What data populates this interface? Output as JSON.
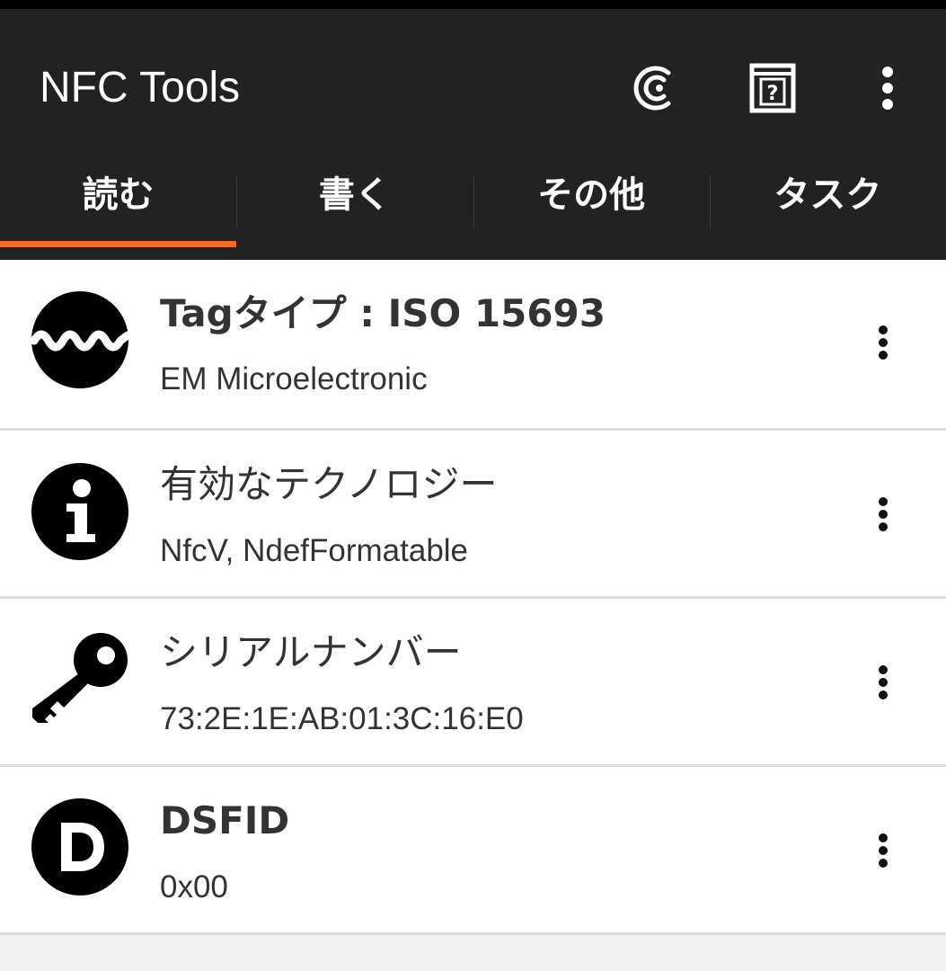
{
  "app": {
    "title": "NFC Tools",
    "actions": [
      {
        "icon": "nfc-c-icon"
      },
      {
        "icon": "help-box-icon",
        "symbol": "?"
      },
      {
        "icon": "overflow-menu-icon"
      }
    ]
  },
  "tabs": [
    {
      "label": "読む",
      "selected": true
    },
    {
      "label": "書く",
      "selected": false
    },
    {
      "label": "その他",
      "selected": false
    },
    {
      "label": "タスク",
      "selected": false
    }
  ],
  "colors": {
    "appbar": "#222222",
    "accent": "#ef6c2e",
    "text": "#333333"
  },
  "records": [
    {
      "icon": "waveform-icon",
      "title": "Tagタイプ : ISO 15693",
      "value": "EM Microelectronic"
    },
    {
      "icon": "info-icon",
      "title": "有効なテクノロジー",
      "value": "NfcV, NdefFormatable"
    },
    {
      "icon": "key-icon",
      "title": "シリアルナンバー",
      "value": "73:2E:1E:AB:01:3C:16:E0"
    },
    {
      "icon": "d-letter-icon",
      "title": "DSFID",
      "value": "0x00"
    }
  ]
}
